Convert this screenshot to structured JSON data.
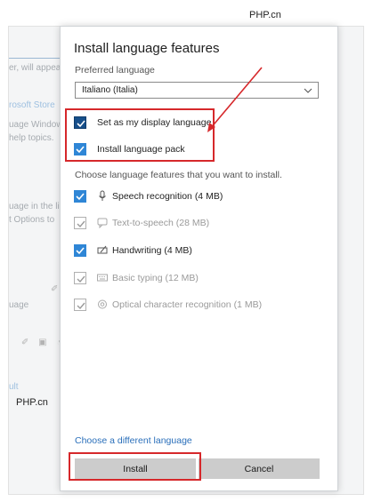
{
  "watermarks": {
    "top": "PHP.cn",
    "left": "PHP.cn"
  },
  "background_window": {
    "fragments": [
      "er, will appea",
      "rosoft Store",
      "uage Window",
      "help topics.",
      "uage in the li",
      "t Options to",
      "uage",
      "ult"
    ]
  },
  "dialog": {
    "title": "Install language features",
    "preferred_label": "Preferred language",
    "preferred_value": "Italiano (Italia)",
    "options": [
      {
        "label": "Set as my display language",
        "checked": true
      },
      {
        "label": "Install language pack",
        "checked": true
      }
    ],
    "features_label": "Choose language features that you want to install.",
    "features": [
      {
        "label": "Speech recognition (4 MB)",
        "icon": "microphone-icon",
        "checked": true,
        "enabled": true
      },
      {
        "label": "Text-to-speech (28 MB)",
        "icon": "speech-bubble-icon",
        "checked": true,
        "enabled": false
      },
      {
        "label": "Handwriting (4 MB)",
        "icon": "pen-icon",
        "checked": true,
        "enabled": true
      },
      {
        "label": "Basic typing (12 MB)",
        "icon": "keyboard-icon",
        "checked": true,
        "enabled": false
      },
      {
        "label": "Optical character recognition (1 MB)",
        "icon": "ocr-icon",
        "checked": true,
        "enabled": false
      }
    ],
    "different_language_link": "Choose a different language",
    "install_button": "Install",
    "cancel_button": "Cancel"
  },
  "colors": {
    "accent": "#2f86d6",
    "annotation": "#d6282b",
    "link": "#2a6fba"
  }
}
